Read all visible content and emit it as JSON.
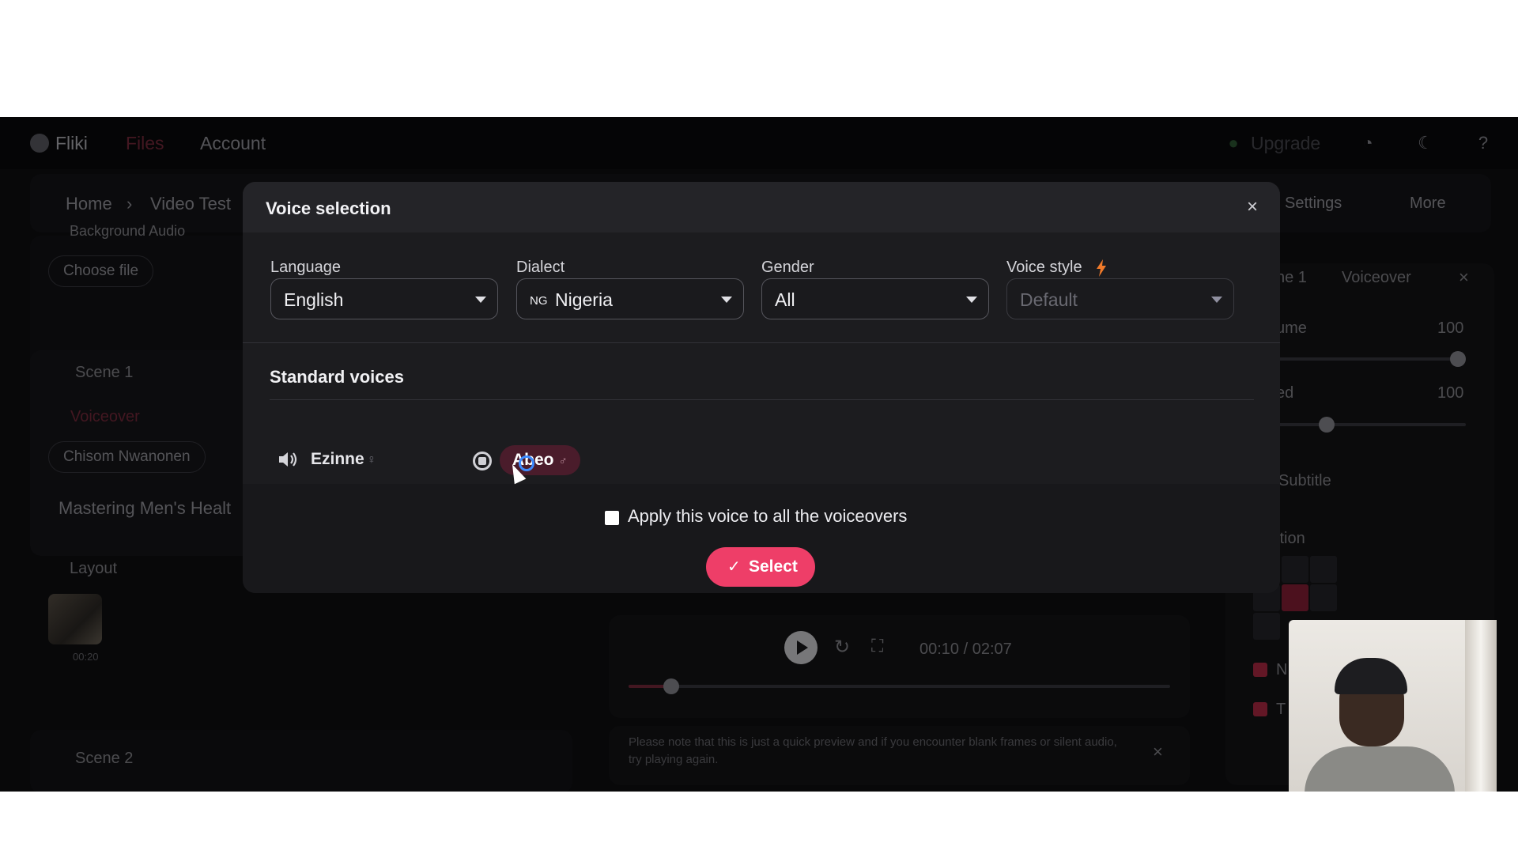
{
  "nav": {
    "brand": "Fliki",
    "files": "Files",
    "account": "Account",
    "upgrade": "Upgrade"
  },
  "breadcrumb": {
    "home": "Home",
    "separator": "›",
    "project": "Video Test",
    "settings": "Settings",
    "more": "More"
  },
  "left_panel": {
    "background_audio": "Background Audio",
    "choose_file": "Choose file",
    "scene1": "Scene 1",
    "voiceover": "Voiceover",
    "voice_pill": "Chisom Nwanonen",
    "script_text": "Mastering Men's Healt",
    "layout": "Layout",
    "thumb_time": "00:20",
    "scene2": "Scene 2"
  },
  "right_panel": {
    "crumb1": "ne 1",
    "crumb2": "Voiceover",
    "volume_label": "ume",
    "volume_value": "100",
    "speed_label": "ed",
    "speed_value": "100",
    "subtitle": "Subtitle",
    "position": "ition",
    "check1": "N",
    "check2": "T"
  },
  "preview": {
    "time": "00:10 / 02:07",
    "notice": "Please note that this is just a quick preview and if you encounter blank frames or silent audio, try playing again."
  },
  "modal": {
    "title": "Voice selection",
    "close": "×",
    "language_label": "Language",
    "language_value": "English",
    "dialect_label": "Dialect",
    "dialect_prefix": "NG",
    "dialect_value": "Nigeria",
    "gender_label": "Gender",
    "gender_value": "All",
    "voice_style_label": "Voice style",
    "voice_style_value": "Default",
    "section_title": "Standard voices",
    "voice1_name": "Ezinne",
    "voice1_symbol": "♀",
    "voice2_name": "Abeo",
    "voice2_symbol": "♂",
    "apply_label": "Apply this voice to all the voiceovers",
    "select_label": "Select",
    "select_check": "✓"
  },
  "colors": {
    "accent": "#ee3e68",
    "chip_bg": "#4a1c2b",
    "loader": "#3d8bff",
    "bolt": "#f07a2a"
  },
  "icons": [
    "gear-icon",
    "flame-icon",
    "moon-icon",
    "help-icon",
    "close-icon",
    "speaker-icon",
    "stop-icon",
    "bolt-icon",
    "chevron-down-icon",
    "check-icon",
    "play-icon",
    "replay-icon",
    "fullscreen-icon"
  ]
}
